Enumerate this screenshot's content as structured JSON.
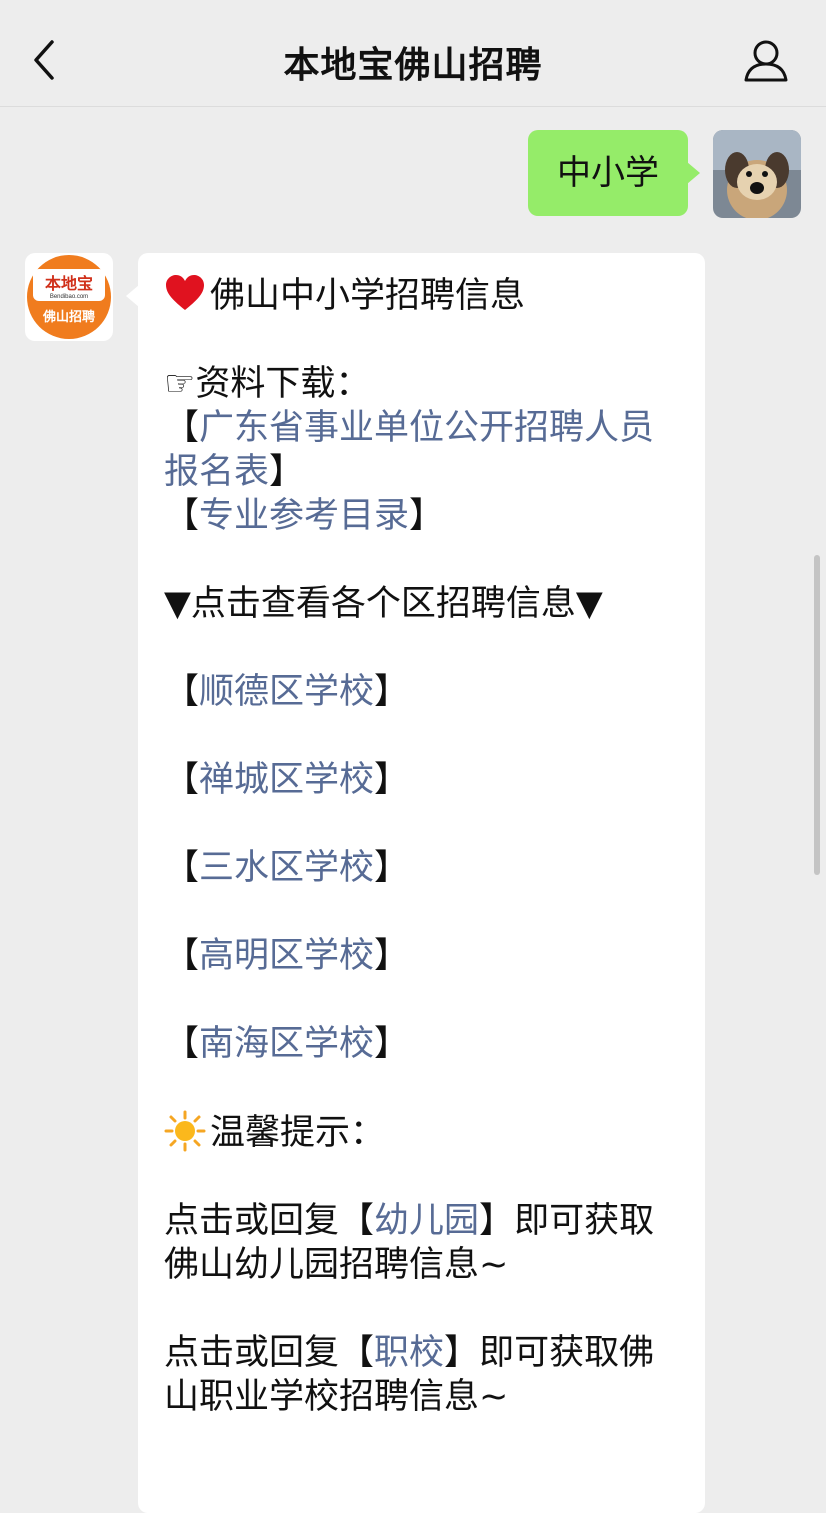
{
  "header": {
    "title": "本地宝佛山招聘",
    "back_icon": "chevron-left-icon",
    "profile_icon": "person-icon"
  },
  "user_message": {
    "text": "中小学",
    "bubble_color": "#95ec69"
  },
  "bot_avatar": {
    "brand_top": "本地宝",
    "brand_site": "Bendibao.com",
    "brand_bottom": "佛山招聘",
    "color": "#f07c1e"
  },
  "bot_message": {
    "title": "佛山中小学招聘信息",
    "download_label": "☞资料下载：",
    "download_links": [
      "广东省事业单位公开招聘人员报名表",
      "专业参考目录"
    ],
    "district_header": "▼点击查看各个区招聘信息▼",
    "districts": [
      "顺德区学校",
      "禅城区学校",
      "三水区学校",
      "高明区学校",
      "南海区学校"
    ],
    "tip_label": "温馨提示：",
    "tips": [
      {
        "prefix": "点击或回复",
        "link": "幼儿园",
        "suffix": "即可获取佛山幼儿园招聘信息~"
      },
      {
        "prefix": "点击或回复",
        "link": "职校",
        "suffix": "即可获取佛山职业学校招聘信息~"
      }
    ],
    "link_color": "#576b95"
  }
}
